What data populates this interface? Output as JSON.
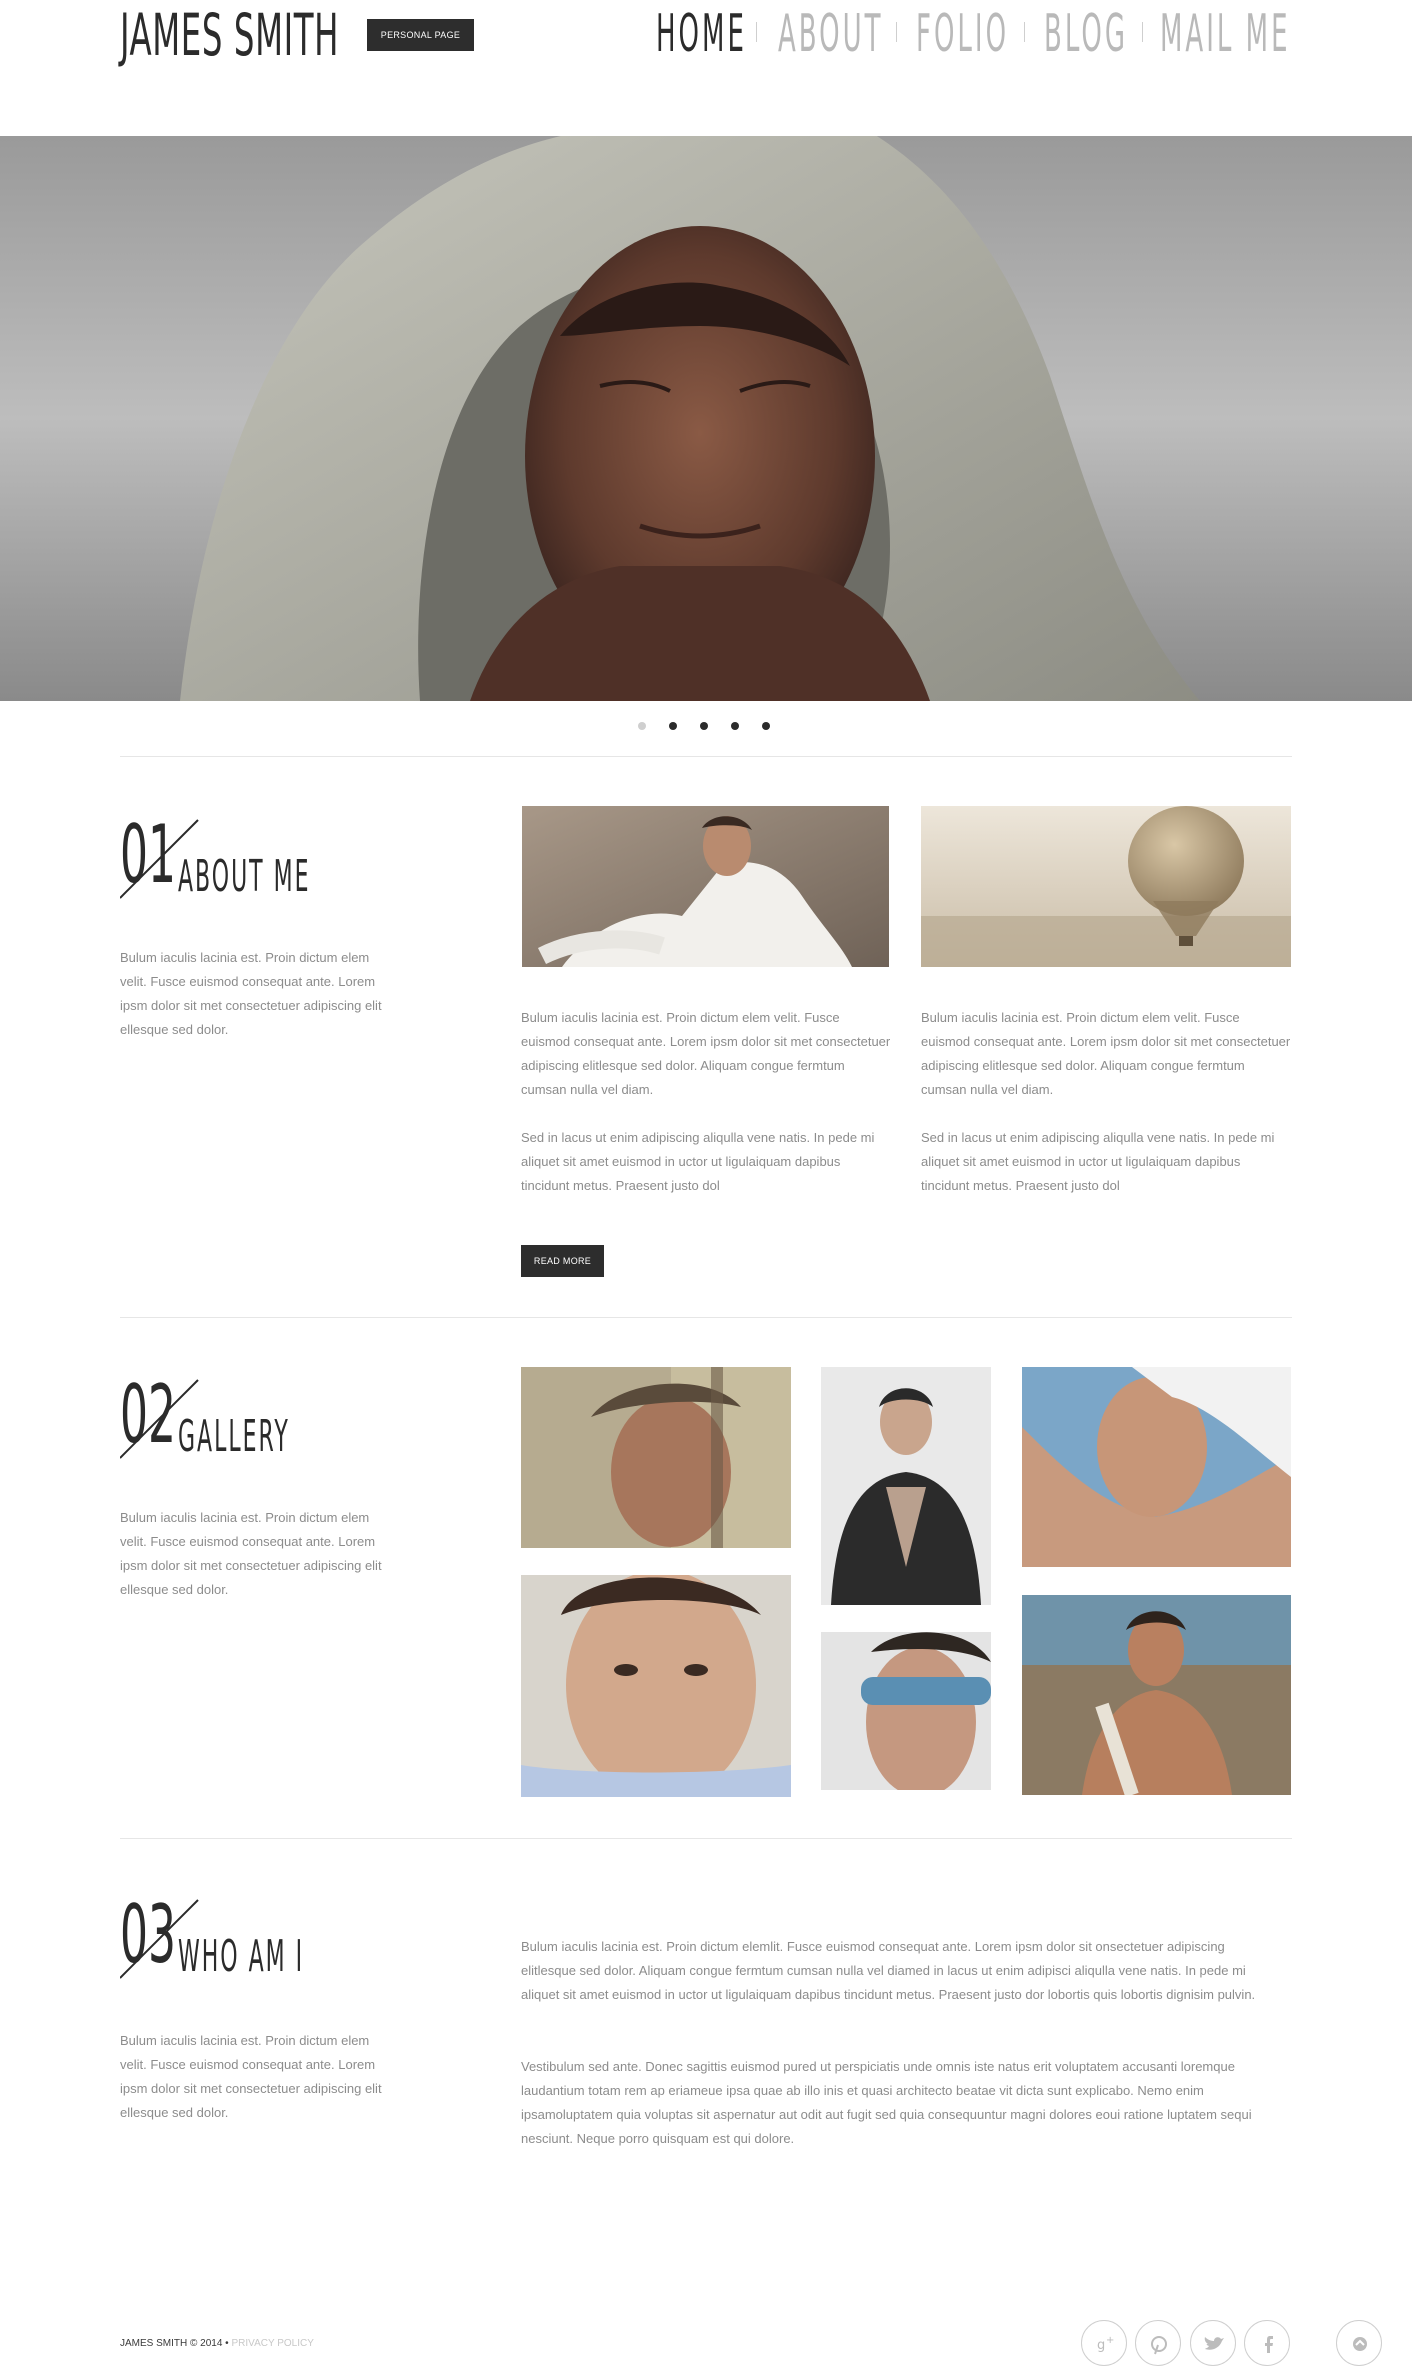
{
  "header": {
    "brand": "JAMES SMITH",
    "badge": "PERSONAL PAGE",
    "nav": [
      "HOME",
      "ABOUT",
      "FOLIO",
      "BLOG",
      "MAIL ME"
    ],
    "active_nav": "HOME"
  },
  "slider": {
    "slide_count": 5,
    "active_index": 0
  },
  "about": {
    "number": "01",
    "title": "ABOUT ME",
    "intro": "Bulum iaculis lacinia est. Proin dictum elem velit. Fusce euismod consequat ante. Lorem ipsm dolor sit met consectetuer adipiscing elit ellesque sed dolor.",
    "col1_p1": "Bulum iaculis lacinia est. Proin dictum elem velit. Fusce euismod consequat ante. Lorem ipsm dolor sit met consectetuer adipiscing elitlesque sed dolor. Aliquam congue fermtum cumsan nulla vel diam.",
    "col1_p2": "Sed in lacus ut enim adipiscing aliqulla vene natis. In pede mi aliquet sit amet euismod in uctor ut ligulaiquam dapibus tincidunt metus. Praesent justo dol",
    "col2_p1": "Bulum iaculis lacinia est. Proin dictum elem velit. Fusce euismod consequat ante. Lorem ipsm dolor sit met consectetuer adipiscing elitlesque sed dolor. Aliquam congue fermtum cumsan nulla vel diam.",
    "col2_p2": "Sed in lacus ut enim adipiscing aliqulla vene natis. In pede mi aliquet sit amet euismod in uctor ut ligulaiquam dapibus tincidunt metus. Praesent justo dol",
    "read_more": "READ MORE"
  },
  "gallery": {
    "number": "02",
    "title": "GALLERY",
    "intro": "Bulum iaculis lacinia est. Proin dictum elem velit. Fusce euismod consequat ante. Lorem ipsm dolor sit met consectetuer adipiscing elit ellesque sed dolor."
  },
  "who": {
    "number": "03",
    "title": "WHO AM I",
    "intro": "Bulum iaculis lacinia est. Proin dictum elem velit. Fusce euismod consequat ante. Lorem ipsm dolor sit met consectetuer adipiscing elit ellesque sed dolor.",
    "p1": "Bulum iaculis lacinia est. Proin dictum elemlit. Fusce euismod consequat ante. Lorem ipsm dolor sit onsectetuer adipiscing elitlesque sed dolor. Aliquam congue fermtum cumsan nulla vel diamed in lacus ut enim adipisci aliqulla vene natis. In pede mi aliquet sit amet euismod in uctor ut ligulaiquam dapibus tincidunt metus. Praesent justo dor lobortis quis lobortis dignisim pulvin.",
    "p2": "Vestibulum sed ante. Donec sagittis euismod pured ut perspiciatis unde omnis iste natus erit voluptatem accusanti loremque laudantium totam rem ap eriameue ipsa quae ab illo inis et quasi architecto beatae vit dicta sunt explicabo. Nemo enim ipsamoluptatem quia voluptas sit aspernatur aut odit aut fugit sed quia consequuntur magni dolores eoui ratione luptatem sequi nesciunt. Neque porro quisquam est qui dolore."
  },
  "footer": {
    "copyright": "JAMES SMITH © 2014 •",
    "privacy": "PRIVACY POLICY",
    "social_icons": [
      "google-plus-icon",
      "pinterest-icon",
      "twitter-icon",
      "facebook-icon",
      "scroll-top-icon"
    ]
  }
}
